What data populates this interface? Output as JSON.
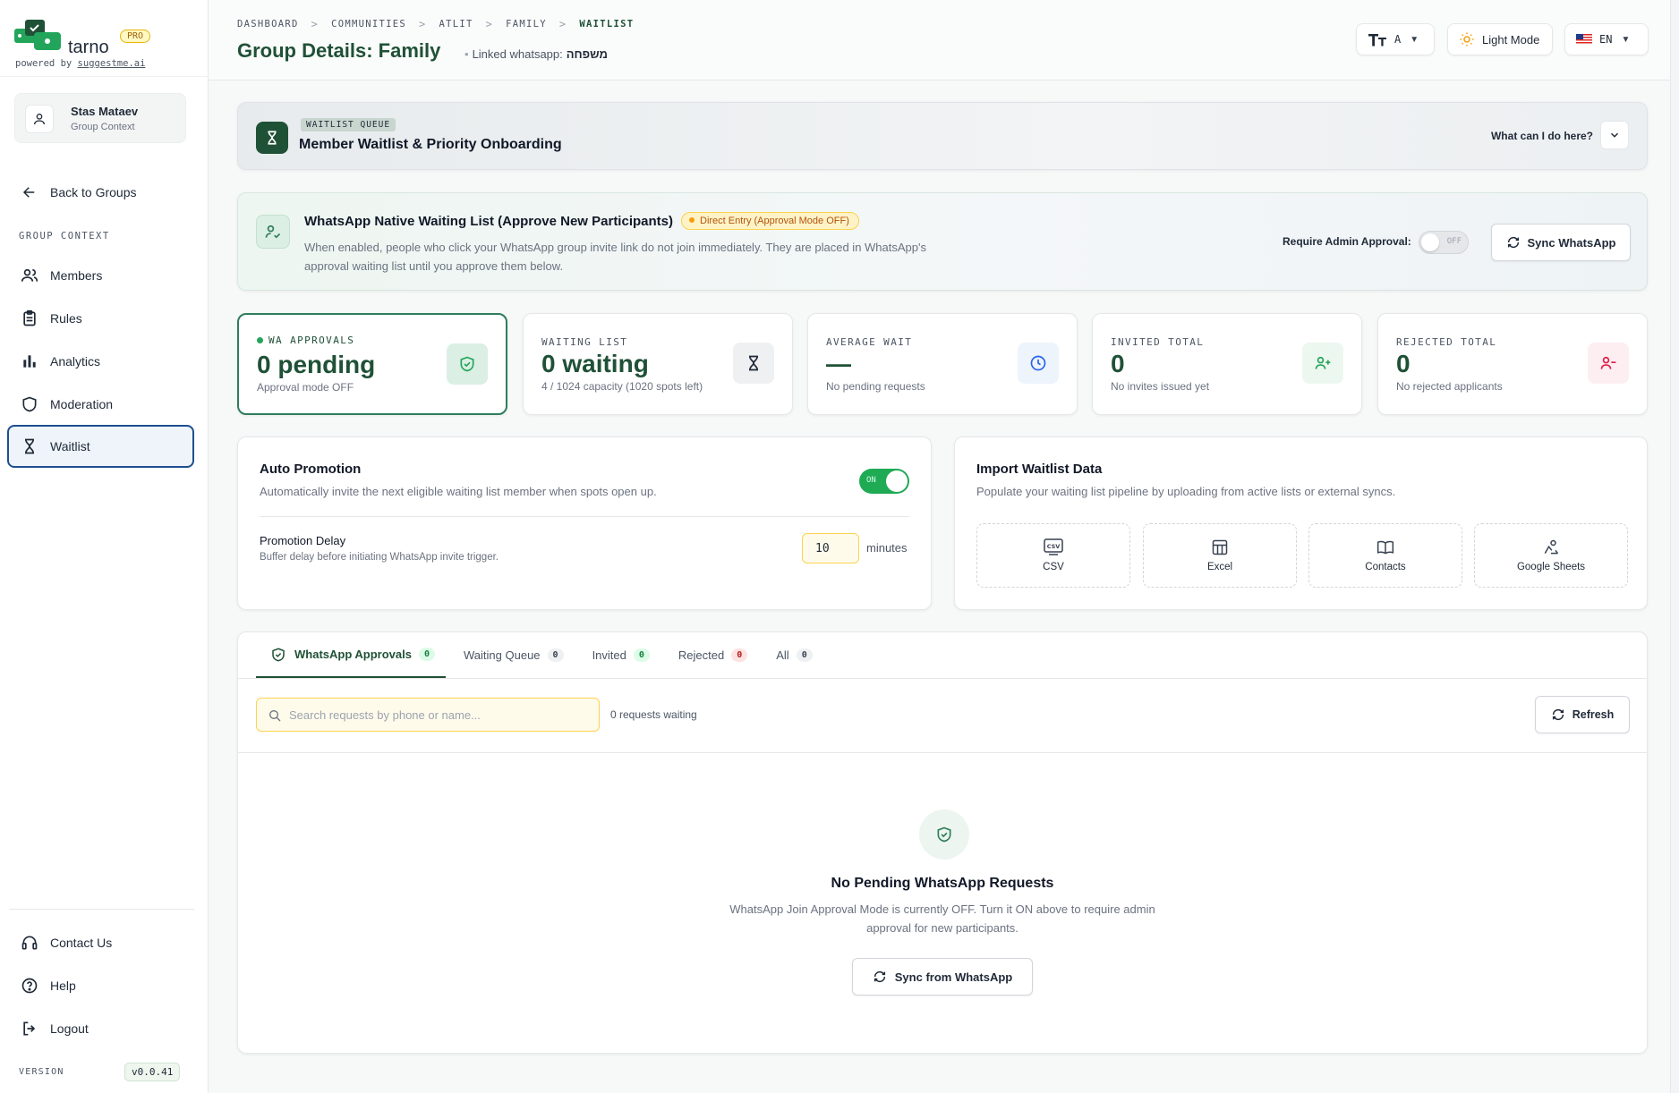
{
  "brand": {
    "name": "tarno",
    "pro_badge": "PRO",
    "powered_prefix": "powered by",
    "powered_link": "suggestme.ai"
  },
  "user": {
    "name": "Stas Mataev",
    "role": "Group Context"
  },
  "sidebar": {
    "back_label": "Back to Groups",
    "section_label": "GROUP CONTEXT",
    "items": [
      {
        "label": "Members",
        "icon": "users-icon"
      },
      {
        "label": "Rules",
        "icon": "clipboard-icon"
      },
      {
        "label": "Analytics",
        "icon": "bar-chart-icon"
      },
      {
        "label": "Moderation",
        "icon": "shield-icon"
      },
      {
        "label": "Waitlist",
        "icon": "hourglass-icon",
        "active": true
      }
    ],
    "footer": [
      {
        "label": "Contact Us",
        "icon": "headset-icon"
      },
      {
        "label": "Help",
        "icon": "help-circle-icon"
      },
      {
        "label": "Logout",
        "icon": "logout-icon"
      }
    ],
    "version_label": "VERSION",
    "version": "v0.0.41"
  },
  "header": {
    "breadcrumb": [
      "DASHBOARD",
      "COMMUNITIES",
      "ATLIT",
      "FAMILY",
      "WAITLIST"
    ],
    "title": "Group Details: Family",
    "linked_label": "Linked whatsapp:",
    "linked_value": "משפחה",
    "font_size_btn": "A",
    "theme_btn": "Light Mode",
    "lang_btn": "EN"
  },
  "queue_banner": {
    "tag": "WAITLIST QUEUE",
    "title": "Member Waitlist & Priority Onboarding",
    "help": "What can I do here?"
  },
  "wa_native": {
    "title": "WhatsApp Native Waiting List (Approve New Participants)",
    "badge": "Direct Entry (Approval Mode OFF)",
    "description": "When enabled, people who click your WhatsApp group invite link do not join immediately. They are placed in WhatsApp's approval waiting list until you approve them below.",
    "approval_label": "Require Admin Approval:",
    "toggle_state": "OFF",
    "sync_button": "Sync WhatsApp"
  },
  "stats": [
    {
      "label": "WA APPROVALS",
      "value": "0 pending",
      "sub": "Approval mode OFF",
      "icon": "shield-check-icon"
    },
    {
      "label": "WAITING LIST",
      "value": "0 waiting",
      "sub": "4 / 1024 capacity (1020 spots left)",
      "icon": "hourglass-icon"
    },
    {
      "label": "AVERAGE WAIT",
      "value": "—",
      "sub": "No pending requests",
      "icon": "clock-icon"
    },
    {
      "label": "INVITED TOTAL",
      "value": "0",
      "sub": "No invites issued yet",
      "icon": "user-plus-icon"
    },
    {
      "label": "REJECTED TOTAL",
      "value": "0",
      "sub": "No rejected applicants",
      "icon": "user-minus-icon"
    }
  ],
  "auto_promotion": {
    "title": "Auto Promotion",
    "description": "Automatically invite the next eligible waiting list member when spots open up.",
    "toggle_state": "ON",
    "delay_title": "Promotion Delay",
    "delay_desc": "Buffer delay before initiating WhatsApp invite trigger.",
    "delay_value": "10",
    "delay_unit": "minutes"
  },
  "import": {
    "title": "Import Waitlist Data",
    "description": "Populate your waiting list pipeline by uploading from active lists or external syncs.",
    "options": [
      {
        "label": "CSV",
        "icon": "csv-file-icon"
      },
      {
        "label": "Excel",
        "icon": "table-icon"
      },
      {
        "label": "Contacts",
        "icon": "book-open-icon"
      },
      {
        "label": "Google Sheets",
        "icon": "sheets-sync-icon"
      }
    ]
  },
  "tabs": [
    {
      "label": "WhatsApp Approvals",
      "count": "0",
      "active": true
    },
    {
      "label": "Waiting Queue",
      "count": "0"
    },
    {
      "label": "Invited",
      "count": "0"
    },
    {
      "label": "Rejected",
      "count": "0"
    },
    {
      "label": "All",
      "count": "0"
    }
  ],
  "list": {
    "search_placeholder": "Search requests by phone or name...",
    "count_text": "0 requests waiting",
    "refresh_button": "Refresh"
  },
  "empty": {
    "title": "No Pending WhatsApp Requests",
    "description": "WhatsApp Join Approval Mode is currently OFF. Turn it ON above to require admin approval for new participants.",
    "button": "Sync from WhatsApp"
  },
  "colors": {
    "brand_green": "#1f5136",
    "accent_green": "#22a55a",
    "active_nav_border": "#1e4f8f",
    "warning_amber": "#f59e0b",
    "danger_red": "#e11d48"
  }
}
